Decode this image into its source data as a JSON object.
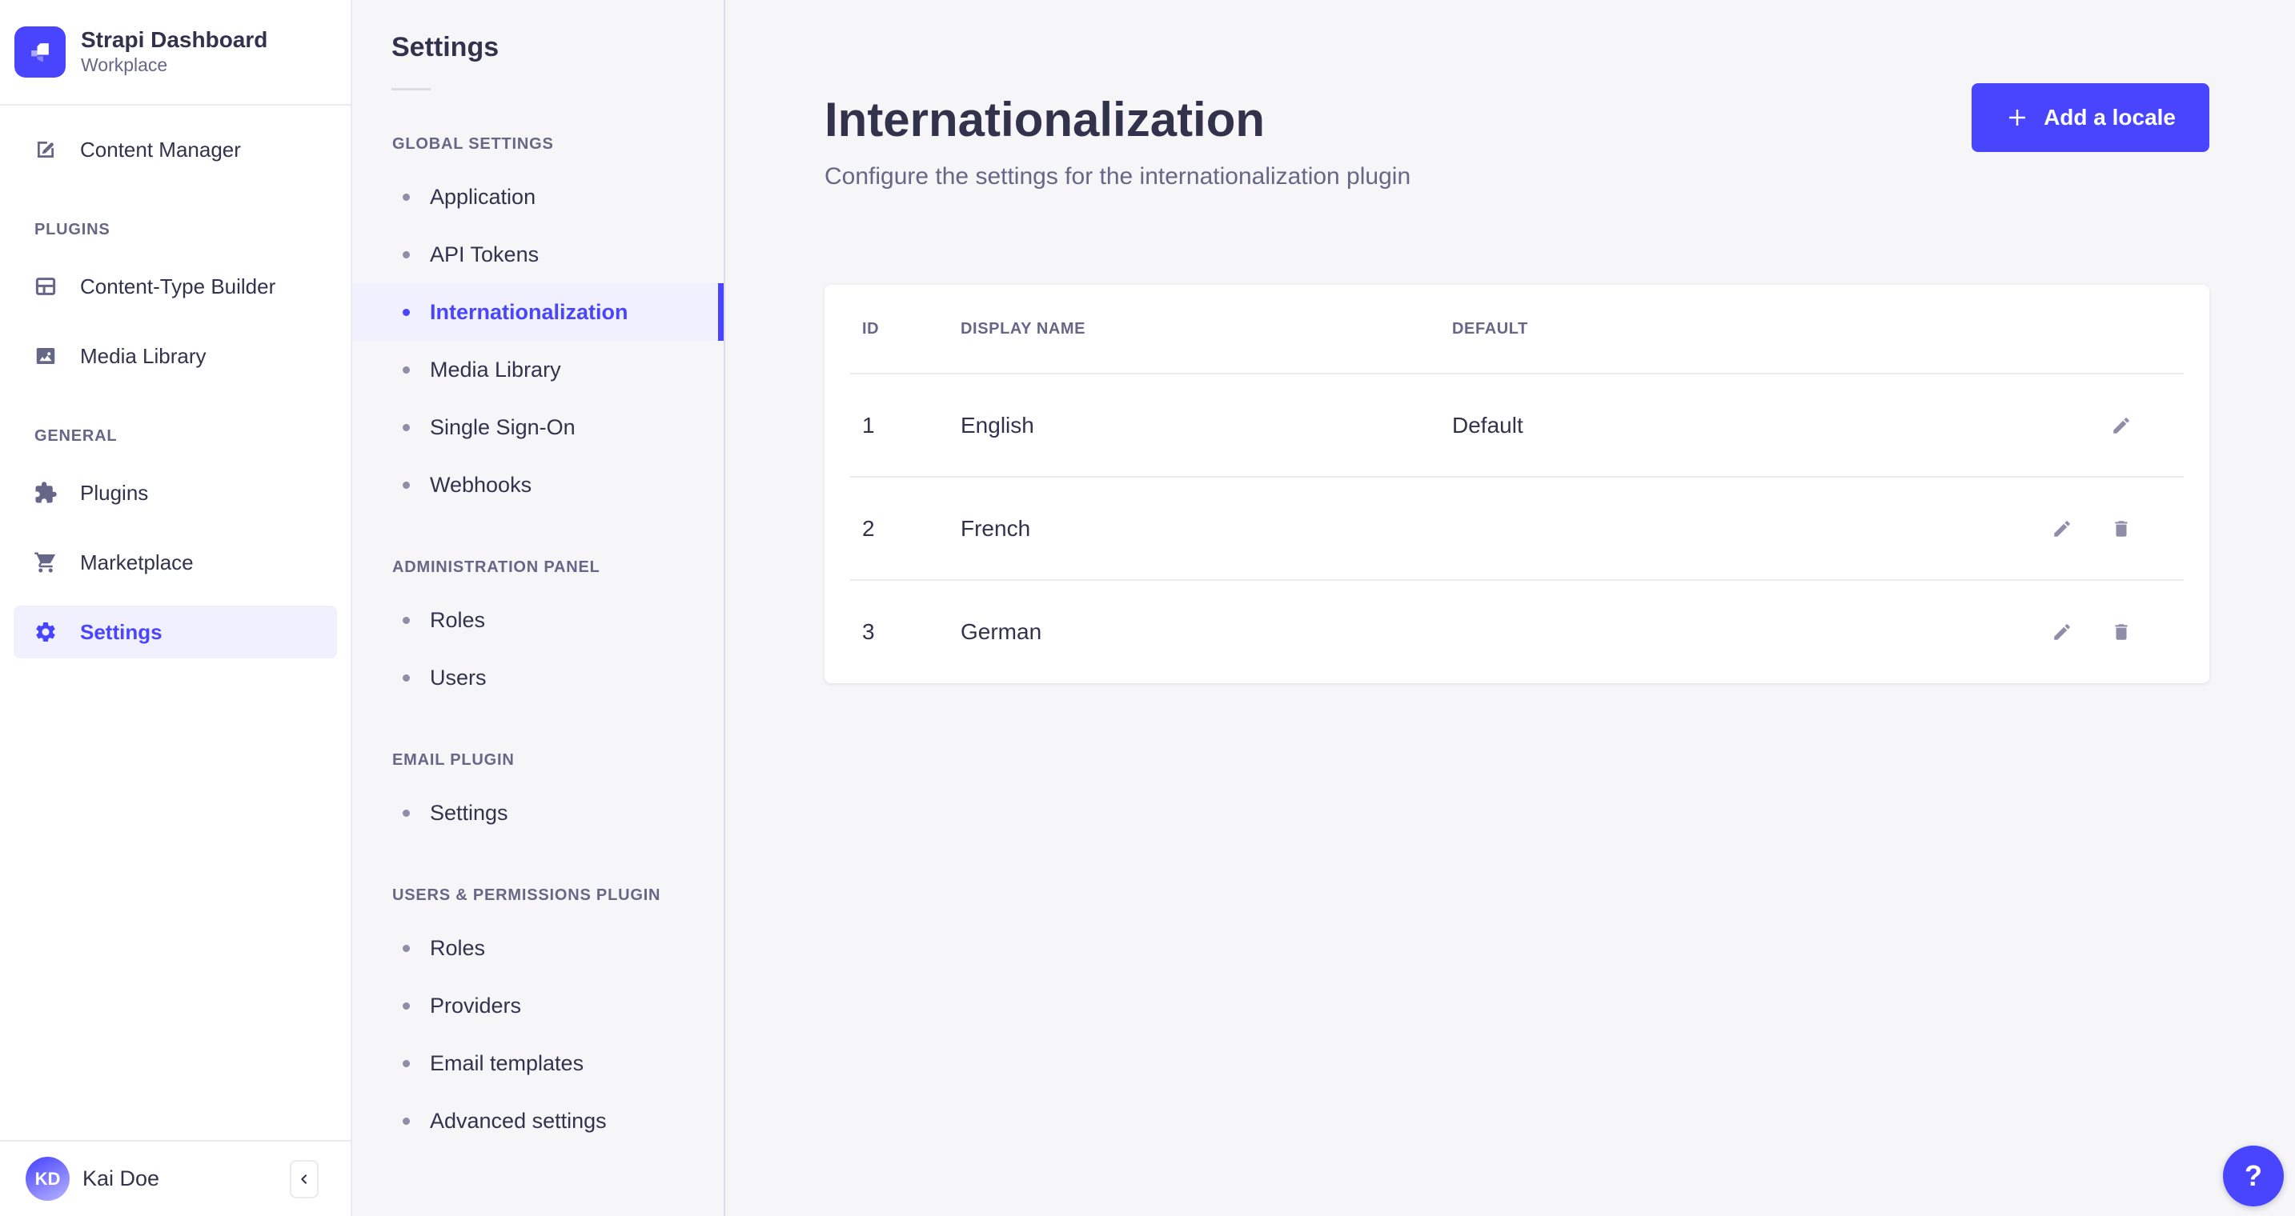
{
  "colors": {
    "primary": "#4945ff",
    "primary_light_bg": "#f0f0ff",
    "background": "#f6f6f9",
    "surface": "#ffffff",
    "border": "#eaeaef",
    "text_dark": "#32324d",
    "text_muted": "#666687",
    "icon_gray": "#8e8ea9"
  },
  "brand": {
    "title": "Strapi Dashboard",
    "subtitle": "Workplace"
  },
  "sidebar": {
    "sections": [
      {
        "header": "",
        "items": [
          {
            "label": "Content Manager",
            "icon": "feather-icon"
          }
        ]
      },
      {
        "header": "PLUGINS",
        "items": [
          {
            "label": "Content-Type Builder",
            "icon": "layout-icon"
          },
          {
            "label": "Media Library",
            "icon": "picture-icon"
          }
        ]
      },
      {
        "header": "GENERAL",
        "items": [
          {
            "label": "Plugins",
            "icon": "puzzle-icon"
          },
          {
            "label": "Marketplace",
            "icon": "cart-icon"
          },
          {
            "label": "Settings",
            "icon": "gear-icon",
            "active": true
          }
        ]
      }
    ],
    "user": {
      "initials": "KD",
      "name": "Kai Doe"
    }
  },
  "subnav": {
    "title": "Settings",
    "sections": [
      {
        "header": "GLOBAL SETTINGS",
        "items": [
          {
            "label": "Application"
          },
          {
            "label": "API Tokens"
          },
          {
            "label": "Internationalization",
            "active": true
          },
          {
            "label": "Media Library"
          },
          {
            "label": "Single Sign-On"
          },
          {
            "label": "Webhooks"
          }
        ]
      },
      {
        "header": "ADMINISTRATION PANEL",
        "items": [
          {
            "label": "Roles"
          },
          {
            "label": "Users"
          }
        ]
      },
      {
        "header": "EMAIL PLUGIN",
        "items": [
          {
            "label": "Settings"
          }
        ]
      },
      {
        "header": "USERS & PERMISSIONS PLUGIN",
        "items": [
          {
            "label": "Roles"
          },
          {
            "label": "Providers"
          },
          {
            "label": "Email templates"
          },
          {
            "label": "Advanced settings"
          }
        ]
      }
    ]
  },
  "main": {
    "page_title": "Internationalization",
    "page_subtitle": "Configure the settings for the internationalization plugin",
    "add_locale_button": "Add a locale",
    "table": {
      "headers": [
        "ID",
        "DISPLAY NAME",
        "DEFAULT"
      ],
      "rows": [
        {
          "id": "1",
          "display_name": "English",
          "default": "Default"
        },
        {
          "id": "2",
          "display_name": "French",
          "default": ""
        },
        {
          "id": "3",
          "display_name": "German",
          "default": ""
        }
      ]
    }
  },
  "help": {
    "label": "?"
  }
}
